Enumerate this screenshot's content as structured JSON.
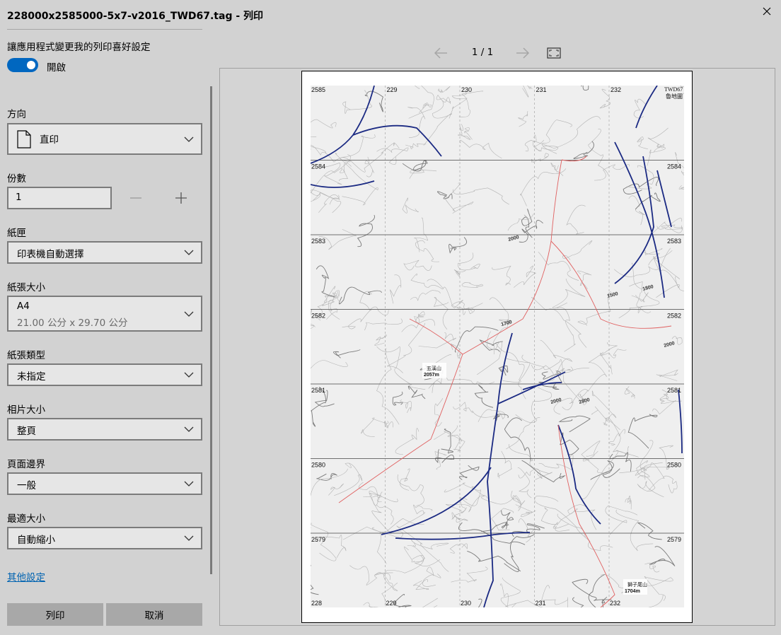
{
  "window": {
    "title": "228000x2585000-5x7-v2016_TWD67.tag - 列印",
    "close_icon": "close-icon"
  },
  "app_settings": {
    "label": "讓應用程式變更我的列印喜好設定",
    "toggle_state": "開啟",
    "toggle_on": true,
    "accent_color": "#0067c0"
  },
  "settings": {
    "orientation": {
      "label": "方向",
      "value": "直印",
      "icon": "portrait-page-icon"
    },
    "copies": {
      "label": "份數",
      "value": "1"
    },
    "tray": {
      "label": "紙匣",
      "value": "印表機自動選擇"
    },
    "paper_size": {
      "label": "紙張大小",
      "value": "A4",
      "detail": "21.00 公分 x 29.70 公分"
    },
    "paper_type": {
      "label": "紙張類型",
      "value": "未指定"
    },
    "photo_size": {
      "label": "相片大小",
      "value": "整頁"
    },
    "margins": {
      "label": "頁面邊界",
      "value": "一般"
    },
    "fit": {
      "label": "最適大小",
      "value": "自動縮小"
    },
    "more_settings": "其他設定"
  },
  "actions": {
    "print": "列印",
    "cancel": "取消"
  },
  "preview": {
    "page_counter": "1 / 1",
    "fit_icon": "fit-to-window-icon",
    "map": {
      "corner_label_line1": "TWD67",
      "corner_label_line2": "魯地圖",
      "x_labels": [
        "229",
        "230",
        "231",
        "232"
      ],
      "x_labels_bottom": [
        "228",
        "229",
        "230",
        "231",
        "232"
      ],
      "y_labels": [
        "2585",
        "2584",
        "2583",
        "2582",
        "2581",
        "2580",
        "2579"
      ],
      "peaks": [
        {
          "name": "五溪山",
          "elev": "2057m"
        },
        {
          "name": "獅子尾山",
          "elev": "1704m"
        }
      ],
      "contour_labels": [
        "2000",
        "1500",
        "1800",
        "2800",
        "1700",
        "2000",
        "2000"
      ]
    }
  }
}
